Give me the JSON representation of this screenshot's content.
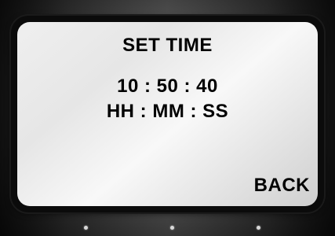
{
  "screen": {
    "title": "SET TIME",
    "time_value": "10 : 50 : 40",
    "time_format": "HH : MM : SS",
    "back_label": "BACK"
  },
  "colors": {
    "text": "#000000",
    "screen_bg": "#ececec",
    "bezel": "#0b0b0b"
  }
}
